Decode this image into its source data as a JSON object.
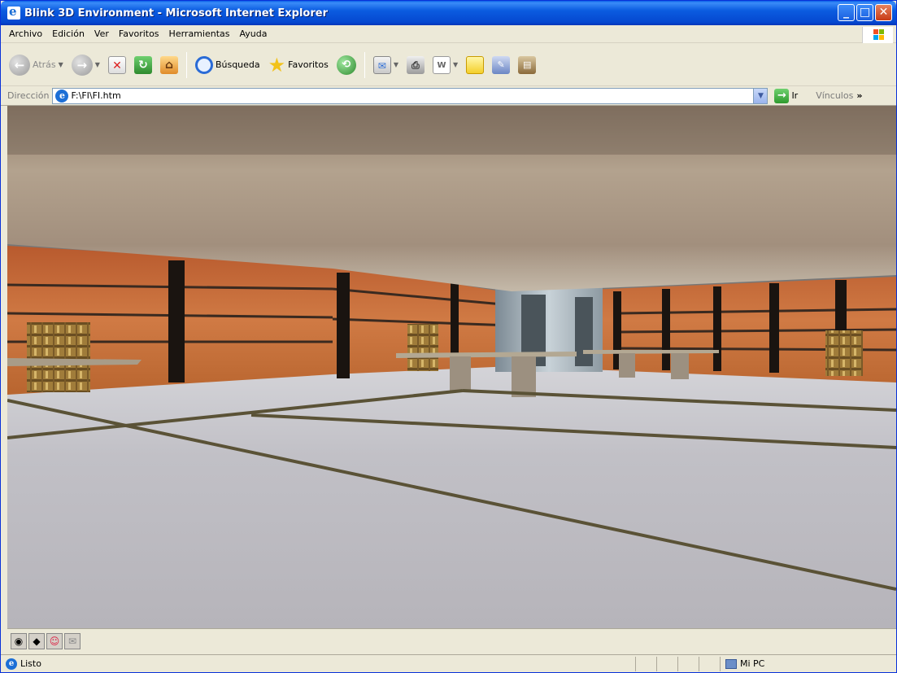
{
  "window": {
    "title": "Blink 3D Environment - Microsoft Internet Explorer"
  },
  "menu": [
    "Archivo",
    "Edición",
    "Ver",
    "Favoritos",
    "Herramientas",
    "Ayuda"
  ],
  "toolbar": {
    "back_label": "Atrás",
    "search_label": "Búsqueda",
    "favorites_label": "Favoritos"
  },
  "address": {
    "label": "Dirección",
    "value": "F:\\FI\\FI.htm",
    "go_label": "Ir",
    "links_label": "Vínculos"
  },
  "status": {
    "text": "Listo",
    "zone": "Mi PC"
  },
  "colors": {
    "titlebar": "#0554d8",
    "ceiling": "#a89780",
    "wall": "#c46a3a",
    "floor": "#c9c8cc"
  }
}
